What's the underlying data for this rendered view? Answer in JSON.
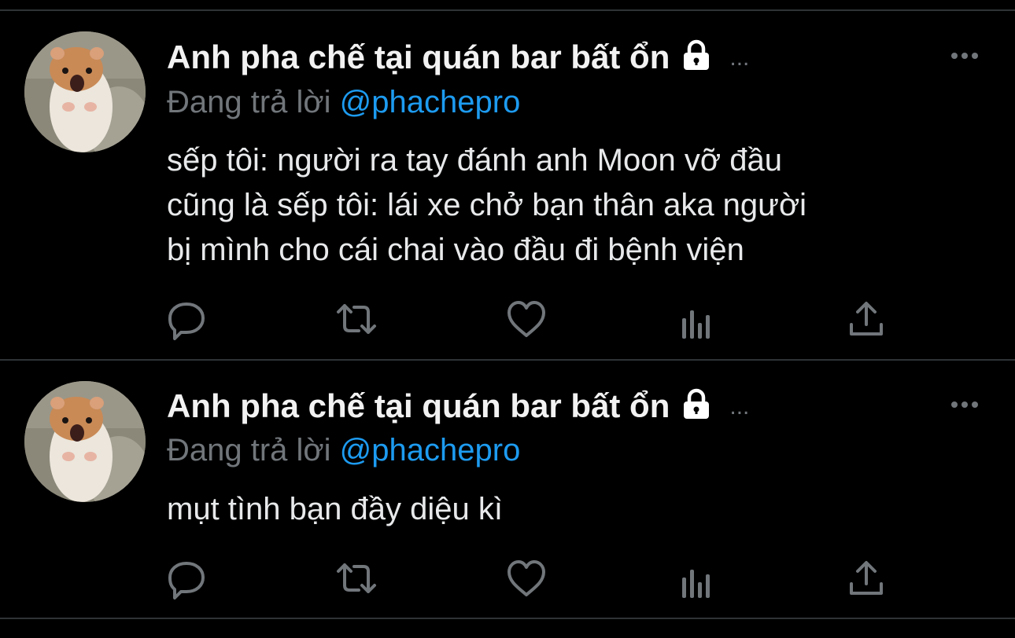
{
  "colors": {
    "background": "#000000",
    "text": "#e7e9ea",
    "secondary": "#71767b",
    "link": "#1d9bf0",
    "divider": "#2f3336"
  },
  "tweets": [
    {
      "display_name": "Anh pha chế tại quán bar bất ổn",
      "locked_icon": "lock-icon",
      "truncation": "...",
      "reply_prefix": "Đang trả lời",
      "reply_handle": "@phachepro",
      "text_lines": [
        "sếp tôi: người ra tay đánh anh Moon vỡ đầu",
        "cũng là sếp tôi: lái xe chở bạn thân aka người",
        "bị mình cho cái chai vào đầu đi bệnh viện"
      ],
      "actions": [
        "reply-icon",
        "retweet-icon",
        "like-icon",
        "analytics-icon",
        "share-icon"
      ]
    },
    {
      "display_name": "Anh pha chế tại quán bar bất ổn",
      "locked_icon": "lock-icon",
      "truncation": "...",
      "reply_prefix": "Đang trả lời",
      "reply_handle": "@phachepro",
      "text_lines": [
        "mụt tình bạn đầy diệu kì"
      ],
      "actions": [
        "reply-icon",
        "retweet-icon",
        "like-icon",
        "analytics-icon",
        "share-icon"
      ]
    }
  ]
}
